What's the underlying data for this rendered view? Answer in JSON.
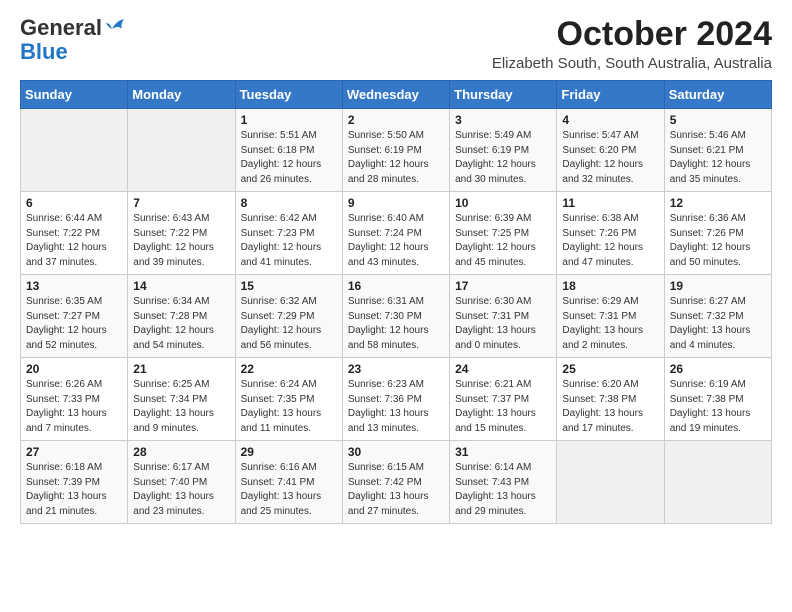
{
  "logo": {
    "general": "General",
    "blue": "Blue"
  },
  "header": {
    "month_year": "October 2024",
    "subtitle": "Elizabeth South, South Australia, Australia"
  },
  "days_of_week": [
    "Sunday",
    "Monday",
    "Tuesday",
    "Wednesday",
    "Thursday",
    "Friday",
    "Saturday"
  ],
  "weeks": [
    [
      {
        "day": "",
        "info": ""
      },
      {
        "day": "",
        "info": ""
      },
      {
        "day": "1",
        "info": "Sunrise: 5:51 AM\nSunset: 6:18 PM\nDaylight: 12 hours and 26 minutes."
      },
      {
        "day": "2",
        "info": "Sunrise: 5:50 AM\nSunset: 6:19 PM\nDaylight: 12 hours and 28 minutes."
      },
      {
        "day": "3",
        "info": "Sunrise: 5:49 AM\nSunset: 6:19 PM\nDaylight: 12 hours and 30 minutes."
      },
      {
        "day": "4",
        "info": "Sunrise: 5:47 AM\nSunset: 6:20 PM\nDaylight: 12 hours and 32 minutes."
      },
      {
        "day": "5",
        "info": "Sunrise: 5:46 AM\nSunset: 6:21 PM\nDaylight: 12 hours and 35 minutes."
      }
    ],
    [
      {
        "day": "6",
        "info": "Sunrise: 6:44 AM\nSunset: 7:22 PM\nDaylight: 12 hours and 37 minutes."
      },
      {
        "day": "7",
        "info": "Sunrise: 6:43 AM\nSunset: 7:22 PM\nDaylight: 12 hours and 39 minutes."
      },
      {
        "day": "8",
        "info": "Sunrise: 6:42 AM\nSunset: 7:23 PM\nDaylight: 12 hours and 41 minutes."
      },
      {
        "day": "9",
        "info": "Sunrise: 6:40 AM\nSunset: 7:24 PM\nDaylight: 12 hours and 43 minutes."
      },
      {
        "day": "10",
        "info": "Sunrise: 6:39 AM\nSunset: 7:25 PM\nDaylight: 12 hours and 45 minutes."
      },
      {
        "day": "11",
        "info": "Sunrise: 6:38 AM\nSunset: 7:26 PM\nDaylight: 12 hours and 47 minutes."
      },
      {
        "day": "12",
        "info": "Sunrise: 6:36 AM\nSunset: 7:26 PM\nDaylight: 12 hours and 50 minutes."
      }
    ],
    [
      {
        "day": "13",
        "info": "Sunrise: 6:35 AM\nSunset: 7:27 PM\nDaylight: 12 hours and 52 minutes."
      },
      {
        "day": "14",
        "info": "Sunrise: 6:34 AM\nSunset: 7:28 PM\nDaylight: 12 hours and 54 minutes."
      },
      {
        "day": "15",
        "info": "Sunrise: 6:32 AM\nSunset: 7:29 PM\nDaylight: 12 hours and 56 minutes."
      },
      {
        "day": "16",
        "info": "Sunrise: 6:31 AM\nSunset: 7:30 PM\nDaylight: 12 hours and 58 minutes."
      },
      {
        "day": "17",
        "info": "Sunrise: 6:30 AM\nSunset: 7:31 PM\nDaylight: 13 hours and 0 minutes."
      },
      {
        "day": "18",
        "info": "Sunrise: 6:29 AM\nSunset: 7:31 PM\nDaylight: 13 hours and 2 minutes."
      },
      {
        "day": "19",
        "info": "Sunrise: 6:27 AM\nSunset: 7:32 PM\nDaylight: 13 hours and 4 minutes."
      }
    ],
    [
      {
        "day": "20",
        "info": "Sunrise: 6:26 AM\nSunset: 7:33 PM\nDaylight: 13 hours and 7 minutes."
      },
      {
        "day": "21",
        "info": "Sunrise: 6:25 AM\nSunset: 7:34 PM\nDaylight: 13 hours and 9 minutes."
      },
      {
        "day": "22",
        "info": "Sunrise: 6:24 AM\nSunset: 7:35 PM\nDaylight: 13 hours and 11 minutes."
      },
      {
        "day": "23",
        "info": "Sunrise: 6:23 AM\nSunset: 7:36 PM\nDaylight: 13 hours and 13 minutes."
      },
      {
        "day": "24",
        "info": "Sunrise: 6:21 AM\nSunset: 7:37 PM\nDaylight: 13 hours and 15 minutes."
      },
      {
        "day": "25",
        "info": "Sunrise: 6:20 AM\nSunset: 7:38 PM\nDaylight: 13 hours and 17 minutes."
      },
      {
        "day": "26",
        "info": "Sunrise: 6:19 AM\nSunset: 7:38 PM\nDaylight: 13 hours and 19 minutes."
      }
    ],
    [
      {
        "day": "27",
        "info": "Sunrise: 6:18 AM\nSunset: 7:39 PM\nDaylight: 13 hours and 21 minutes."
      },
      {
        "day": "28",
        "info": "Sunrise: 6:17 AM\nSunset: 7:40 PM\nDaylight: 13 hours and 23 minutes."
      },
      {
        "day": "29",
        "info": "Sunrise: 6:16 AM\nSunset: 7:41 PM\nDaylight: 13 hours and 25 minutes."
      },
      {
        "day": "30",
        "info": "Sunrise: 6:15 AM\nSunset: 7:42 PM\nDaylight: 13 hours and 27 minutes."
      },
      {
        "day": "31",
        "info": "Sunrise: 6:14 AM\nSunset: 7:43 PM\nDaylight: 13 hours and 29 minutes."
      },
      {
        "day": "",
        "info": ""
      },
      {
        "day": "",
        "info": ""
      }
    ]
  ]
}
